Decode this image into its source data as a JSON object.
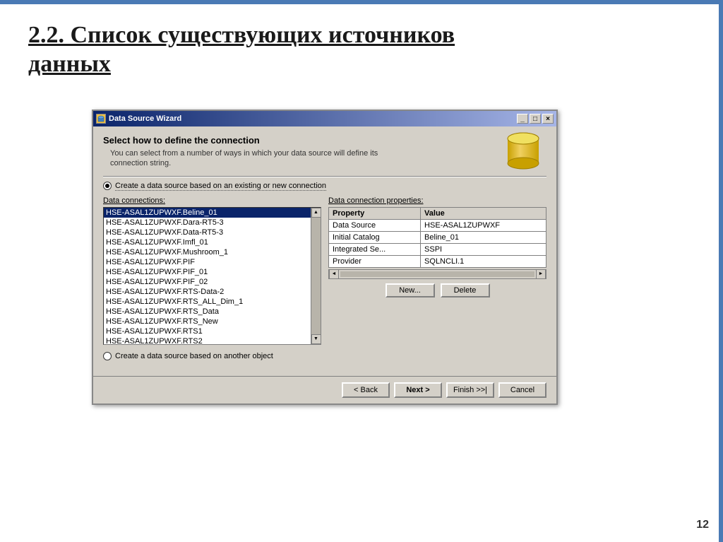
{
  "slide": {
    "title": "2.2. Список существующих источников данных",
    "number": "12"
  },
  "dialog": {
    "title": "Data Source Wizard",
    "header": {
      "title": "Select how to define the connection",
      "subtitle_line1": "You can select from a number of ways in which your data source will define its",
      "subtitle_line2": "connection string."
    },
    "titlebar_buttons": {
      "minimize": "_",
      "maximize": "□",
      "close": "×"
    },
    "radio1": {
      "label": "Create a data source based on an existing or new connection",
      "selected": true
    },
    "radio2": {
      "label": "Create a data source based on another object",
      "selected": false
    },
    "col_left_label": "Data connections:",
    "col_right_label": "Data connection properties:",
    "connections": [
      "HSE-ASAL1ZUPWXF.Beline_01",
      "HSE-ASAL1ZUPWXF.Dara-RT5-3",
      "HSE-ASAL1ZUPWXF.Data-RT5-3",
      "HSE-ASAL1ZUPWXF.Imfl_01",
      "HSE-ASAL1ZUPWXF.Mushroom_1",
      "HSE-ASAL1ZUPWXF.PIF",
      "HSE-ASAL1ZUPWXF.PIF_01",
      "HSE-ASAL1ZUPWXF.PIF_02",
      "HSE-ASAL1ZUPWXF.RTS-Data-2",
      "HSE-ASAL1ZUPWXF.RTS_ALL_Dim_1",
      "HSE-ASAL1ZUPWXF.RTS_Data",
      "HSE-ASAL1ZUPWXF.RTS_New",
      "HSE-ASAL1ZUPWXF.RTS1",
      "HSE-ASAL1ZUPWXF.RTS2"
    ],
    "selected_connection": "HSE-ASAL1ZUPWXF.Beline_01",
    "properties": {
      "headers": [
        "Property",
        "Value"
      ],
      "rows": [
        [
          "Data Source",
          "HSE-ASAL1ZUPWXF"
        ],
        [
          "Initial Catalog",
          "Beline_01"
        ],
        [
          "Integrated Se...",
          "SSPI"
        ],
        [
          "Provider",
          "SQLNCLI.1"
        ]
      ]
    },
    "buttons": {
      "new": "New...",
      "delete": "Delete"
    },
    "footer_buttons": {
      "back": "< Back",
      "next": "Next >",
      "finish": "Finish >>|",
      "cancel": "Cancel"
    }
  }
}
